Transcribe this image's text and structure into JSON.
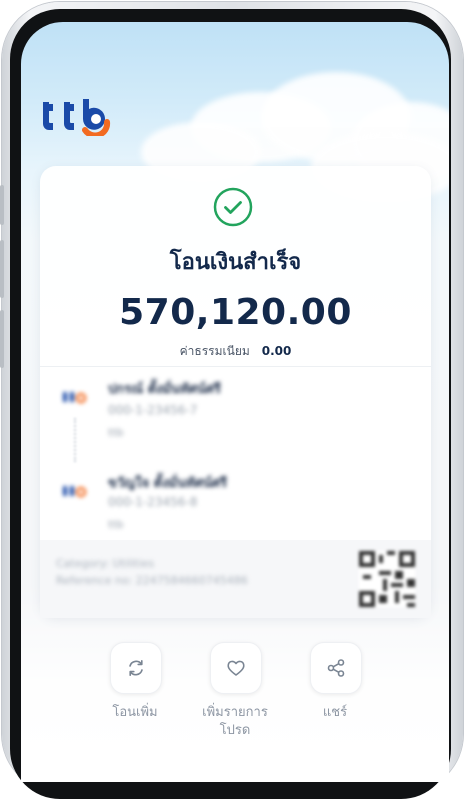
{
  "app": {
    "brand": "ttb",
    "brand_colors": {
      "t": "#1a4aa8",
      "b": "#f26b21"
    }
  },
  "receipt": {
    "status_title": "โอนเงินสำเร็จ",
    "amount": "570,120.00",
    "fee_label": "ค่าธรรมเนียม",
    "fee_value": "0.00",
    "from": {
      "name": "ปกรณ์ ตั้งมั่นทัศน์ศรี",
      "account": "000-1-23456-7",
      "bank": "ttb"
    },
    "to": {
      "name": "ขวัญใจ ตั้งมั่นทัศน์ศรี",
      "account": "000-1-23456-8",
      "bank": "ttb"
    },
    "category": "Category: Utilities",
    "reference": "Reference no: 2247584660745486"
  },
  "actions": [
    {
      "label": "โอนเพิ่ม",
      "icon": "refresh-icon"
    },
    {
      "label": "เพิ่มรายการ\nโปรด",
      "icon": "heart-icon"
    },
    {
      "label": "แชร์",
      "icon": "share-icon"
    }
  ],
  "colors": {
    "success": "#22a45d",
    "title": "#13294b"
  }
}
